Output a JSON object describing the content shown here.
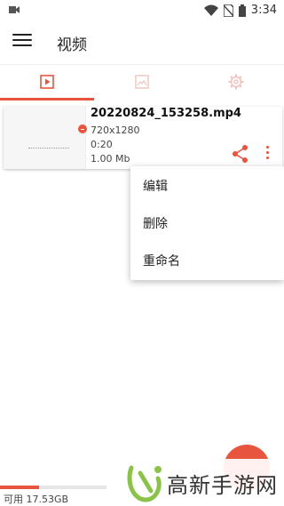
{
  "status_bar": {
    "time": "3:34",
    "icons": [
      "camera-icon",
      "wifi-icon",
      "no-sim-icon",
      "battery-icon"
    ]
  },
  "app_bar": {
    "title": "视频"
  },
  "tabs": {
    "items": [
      {
        "icon": "video-icon",
        "active": true
      },
      {
        "icon": "image-icon",
        "active": false
      },
      {
        "icon": "gear-icon",
        "active": false
      }
    ]
  },
  "video": {
    "file_name": "20220824_153258.mp4",
    "resolution": "720x1280",
    "duration": "0:20",
    "size": "1.00 Mb"
  },
  "context_menu": {
    "items": [
      {
        "label": "编辑"
      },
      {
        "label": "删除"
      },
      {
        "label": "重命名"
      }
    ]
  },
  "storage": {
    "text": "可用 17.53GB",
    "used_fraction": 0.37
  },
  "watermark": {
    "text": "高新手游网"
  },
  "colors": {
    "accent": "#e8553f",
    "text": "#222222",
    "muted": "#bbbbbb"
  }
}
